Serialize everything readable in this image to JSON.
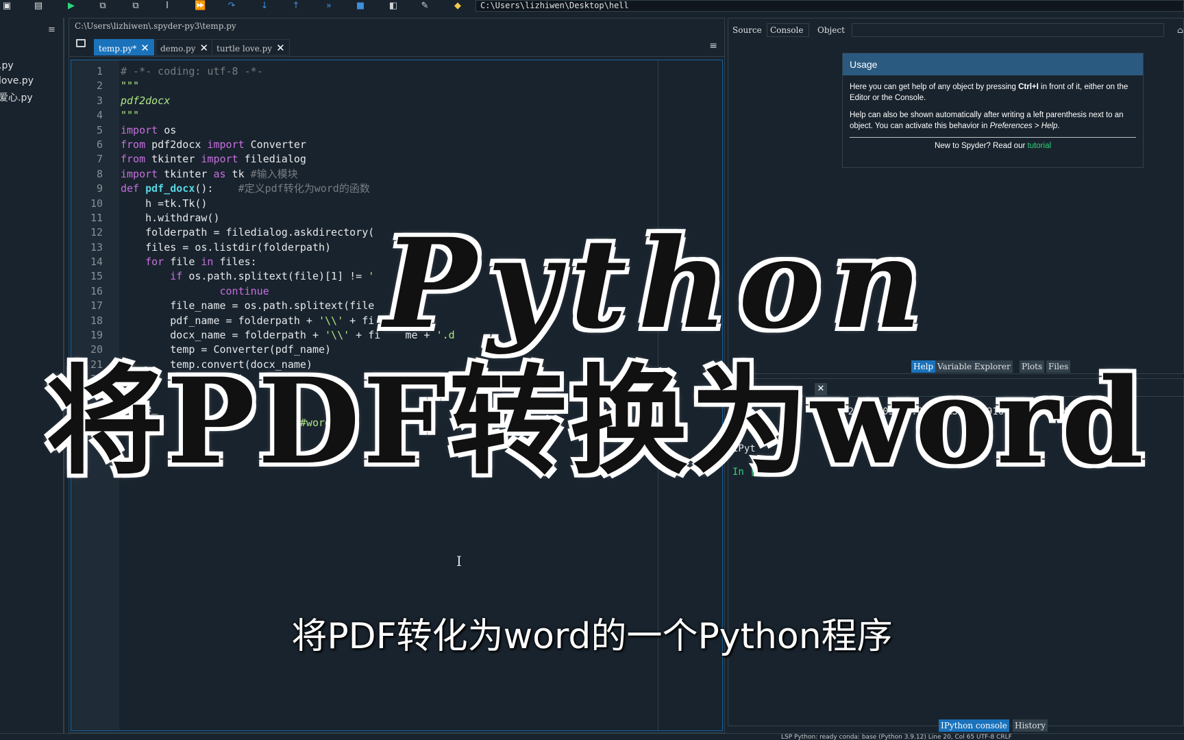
{
  "toolbar": {
    "path": "C:\\Users\\lizhiwen\\Desktop\\hell",
    "icons": [
      "save-icon",
      "save-all-icon",
      "run-icon",
      "run-cell-icon",
      "run-cell-advance-icon",
      "run-selection-icon",
      "debug-icon",
      "step-icon",
      "step-into-icon",
      "step-return-icon",
      "continue-icon",
      "stop-icon",
      "maximize-pane-icon",
      "preferences-icon",
      "python-path-icon"
    ]
  },
  "file_panel": {
    "items": [
      ".py",
      "love.py",
      "爱心.py"
    ]
  },
  "editor": {
    "path": "C:\\Users\\lizhiwen\\.spyder-py3\\temp.py",
    "tabs": [
      {
        "label": "temp.py*",
        "active": true
      },
      {
        "label": "demo.py",
        "active": false
      },
      {
        "label": "turtle love.py",
        "active": false
      }
    ],
    "lines": [
      {
        "n": "1",
        "html": "# -*- coding: utf-8 -*-",
        "cls": "cm"
      },
      {
        "n": "2",
        "html": "\"\"\"",
        "cls": "doc"
      },
      {
        "n": "3",
        "html": "pdf2docx",
        "cls": "doc"
      },
      {
        "n": "4",
        "html": "\"\"\"",
        "cls": "doc"
      },
      {
        "n": "5",
        "tokens": [
          [
            "kw",
            "import"
          ],
          [
            "",
            "os"
          ]
        ]
      },
      {
        "n": "6",
        "tokens": [
          [
            "kw",
            "from"
          ],
          [
            "",
            "pdf2docx"
          ],
          [
            "kw",
            "import"
          ],
          [
            "",
            "Converter"
          ]
        ]
      },
      {
        "n": "7",
        "tokens": [
          [
            "kw",
            "from"
          ],
          [
            "",
            "tkinter"
          ],
          [
            "kw",
            "import"
          ],
          [
            "",
            "filedialog"
          ]
        ]
      },
      {
        "n": "8",
        "tokens": [
          [
            "kw",
            "import"
          ],
          [
            "",
            "tkinter"
          ],
          [
            "kw",
            "as"
          ],
          [
            "",
            "tk"
          ],
          [
            "cm",
            "#输入模块"
          ]
        ]
      },
      {
        "n": "9",
        "tokens": [
          [
            "kw",
            "def"
          ],
          [
            "fn",
            "pdf_docx"
          ],
          [
            "",
            "():    "
          ],
          [
            "cm",
            "#定义pdf转化为word的函数"
          ]
        ]
      },
      {
        "n": "10",
        "text": "    h =tk.Tk()"
      },
      {
        "n": "11",
        "text": "    h.withdraw()"
      },
      {
        "n": "12",
        "text": "    folderpath = filedialog.askdirectory("
      },
      {
        "n": "13",
        "text": "    files = os.listdir(folderpath)"
      },
      {
        "n": "14",
        "tokens": [
          [
            "",
            "    "
          ],
          [
            "kw",
            "for"
          ],
          [
            "",
            " file "
          ],
          [
            "kw",
            "in"
          ],
          [
            "",
            " files:"
          ]
        ]
      },
      {
        "n": "15",
        "tokens": [
          [
            "",
            "        "
          ],
          [
            "kw",
            "if"
          ],
          [
            "",
            " os.path.splitext(file)[1] != "
          ],
          [
            "st",
            "'"
          ]
        ]
      },
      {
        "n": "16",
        "tokens": [
          [
            "",
            "                "
          ],
          [
            "kw",
            "continue"
          ]
        ]
      },
      {
        "n": "17",
        "text": "        file_name = os.path.splitext(file"
      },
      {
        "n": "18",
        "tokens": [
          [
            "",
            "        pdf_name = folderpath + "
          ],
          [
            "st",
            "'\\\\'"
          ],
          [
            "",
            " + fi"
          ]
        ]
      },
      {
        "n": "19",
        "tokens": [
          [
            "",
            "        docx_name = folderpath + "
          ],
          [
            "st",
            "'\\\\'"
          ],
          [
            "",
            " + fi    me + "
          ],
          [
            "st",
            "'.d"
          ]
        ]
      },
      {
        "n": "20",
        "text": "        temp = Converter(pdf_name)"
      },
      {
        "n": "21",
        "text": "        temp.convert(docx_name)"
      },
      {
        "n": "22",
        "text": "        temp.close()"
      },
      {
        "n": "23",
        "text": ""
      },
      {
        "n": "24",
        "text": "    e_"
      },
      {
        "n": "25",
        "tokens": [
          [
            "",
            "            showi"
          ],
          [
            "st",
            "            #word"
          ],
          [
            "",
            " "
          ],
          [
            "st",
            "'')"
          ]
        ]
      }
    ]
  },
  "help": {
    "source_label": "Source",
    "source_value": "Console",
    "object_label": "Object",
    "usage_title": "Usage",
    "usage_p1_a": "Here you can get help of any object by pressing ",
    "usage_p1_key": "Ctrl+I",
    "usage_p1_b": " in front of it, either on the Editor or the Console.",
    "usage_p2_a": "Help can also be shown automatically after writing a left parenthesis next to an object. You can activate this behavior in ",
    "usage_p2_pref": "Preferences > Help",
    "usage_p2_b": ".",
    "usage_foot": "New to Spyder? Read our ",
    "usage_link": "tutorial",
    "tabs": [
      "Help",
      "Variable Explorer",
      "Plots",
      "Files"
    ]
  },
  "console": {
    "line1": "Py                4 2022, 05:22:27) [MSC v.1916 64 bit (AMD",
    "line2": "Ty",
    "line3": "IPyt",
    "prompt": "In [",
    "tabs": [
      "IPython console",
      "History"
    ]
  },
  "statusbar": {
    "text": "LSP Python: ready     conda: base (Python 3.9.12)   Line 20, Col 65   UTF-8   CRLF"
  },
  "overlay": {
    "title_line1": "Python",
    "title_line2": "将PDF转换为word",
    "subtitle": "将PDF转化为word的一个Python程序"
  },
  "colors": {
    "background": "#19232d",
    "accent": "#1a72bb",
    "keyword": "#c670e0",
    "function": "#57d6e4",
    "string": "#b0e686",
    "comment": "#777c82"
  }
}
